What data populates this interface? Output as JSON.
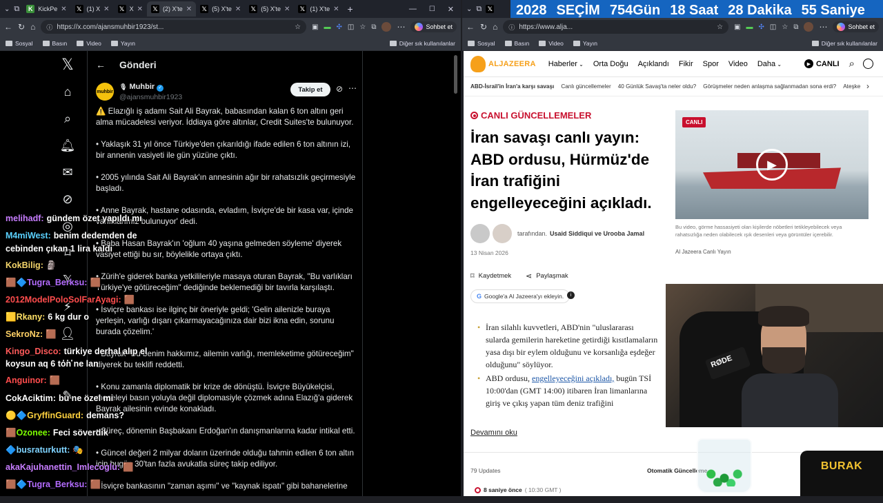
{
  "left_browser": {
    "tabs": [
      {
        "label": "KickPe",
        "active": false
      },
      {
        "label": "(1) X",
        "active": false
      },
      {
        "label": "X",
        "active": false
      },
      {
        "label": "(2) X'te",
        "active": true
      },
      {
        "label": "(5) X'te",
        "active": false
      },
      {
        "label": "(5) X'te",
        "active": false
      },
      {
        "label": "(1) X'te",
        "active": false
      }
    ],
    "url": "https://x.com/ajansmuhbir1923/st...",
    "copilot_label": "Sohbet et",
    "bookmarks": [
      "Sosyal",
      "Basın",
      "Video",
      "Yayın"
    ],
    "other_bookmarks": "Diğer sık kullanılanlar"
  },
  "x_post": {
    "header_title": "Gönderi",
    "author_name": "Muhbir",
    "author_handle": "@ajansmuhbir1923",
    "avatar_text": "muhbir",
    "follow_label": "Takip et",
    "paragraphs": [
      "⚠️ Elazığlı iş adamı Sait Ali Bayrak, babasından kalan 6 ton altını geri alma mücadelesi veriyor. İddiaya göre altınlar, Credit Suites'te bulunuyor.",
      "• Yaklaşık 31 yıl önce Türkiye'den çıkarıldığı ifade edilen 6 ton altının izi, bir annenin vasiyeti ile gün yüzüne çıktı.",
      "• 2005 yılında Sait Ali Bayrak'ın annesinin ağır bir rahatsızlık geçirmesiyle başladı.",
      "• Anne Bayrak, hastane odasında, evladım, İsviçre'de bir kasa var, içinde varlıklarımız bulunuyor' dedi.",
      "• Baba Hasan Bayrak'ın 'oğlum 40 yaşına gelmeden söyleme' diyerek vasiyet ettiği bu sır, böylelikle ortaya çıktı.",
      "• Zürih'e giderek banka yetkilileriyle masaya oturan Bayrak, \"Bu varlıkları Türkiye'ye götüreceğim\" dediğinde beklemediği bir tavırla karşılaştı.",
      "• İsviçre bankası ise ilginç bir öneriyle geldi; 'Gelin ailenizle buraya yerleşin, varlığı dışarı çıkarmayacağınıza dair bizi ikna edin, sorunu burada çözelim.'",
      "• Bayrak \"Bu benim hakkımız, ailemin varlığı, memleketime götüreceğim\" diyerek bu teklifi reddetti.",
      "• Konu zamanla diplomatik bir krize de dönüştü. İsviçre Büyükelçisi, meseleyi basın yoluyla değil diplomasiyle çözmek adına Elazığ'a giderek Bayrak ailesinin evinde konakladı.",
      "• Süreç, dönemin Başbakanı Erdoğan'ın danışmanlarına kadar intikal etti.",
      "• Güncel değeri 2 milyar doların üzerinde olduğu tahmin edilen 6 ton altın için bugün 30'tan fazla avukatla süreç takip ediliyor.",
      "• İsviçre bankasının \"zaman aşımı\" ve \"kaynak ispatı\" gibi bahanelerine"
    ]
  },
  "chat": [
    {
      "user": "melihadf:",
      "user_color": "#c77dff",
      "msg": "gündem özet yapıldı mı"
    },
    {
      "user": "M4miWest:",
      "user_color": "#5ad1ff",
      "msg": "benim dedemden de"
    },
    {
      "user": "",
      "user_color": "#fff",
      "msg": "cebinden çıkan 1 lira kaldı"
    },
    {
      "user": "KokBilig:",
      "user_color": "#f5d66b",
      "msg": "🗿"
    },
    {
      "user": "Tugra_Berksu:",
      "user_color": "#b46cff",
      "msg": "🟫"
    },
    {
      "user": "2012ModelPoloSolFarAyagi:",
      "user_color": "#ff4d4d",
      "msg": "🟫"
    },
    {
      "user": "Rkany:",
      "user_color": "#ffe066",
      "msg": "6 kg dur o"
    },
    {
      "user": "SekroNz:",
      "user_color": "#ffd166",
      "msg": "🟫"
    },
    {
      "user": "Kingo_Disco:",
      "user_color": "#ff5a5a",
      "msg": "türkiye derhal alıp el"
    },
    {
      "user": "",
      "user_color": "#fff",
      "msg": "koysun aq 6 ton ne lan"
    },
    {
      "user": "Anguinor:",
      "user_color": "#ff4d4d",
      "msg": "🟫"
    },
    {
      "user": "CokAciktim:",
      "user_color": "#ffffff",
      "msg": "bu ne özel mi"
    },
    {
      "user": "GryffinGuard:",
      "user_color": "#ffd23f",
      "msg": "demans?"
    },
    {
      "user": "Ozonee:",
      "user_color": "#7CFC00",
      "msg": "Feci söverdik"
    },
    {
      "user": "busraturkutt:",
      "user_color": "#7fd3ff",
      "msg": "🎭"
    },
    {
      "user": "akaKajuhanettin_Imlecoglu:",
      "user_color": "#c77dff",
      "msg": "🟫"
    },
    {
      "user": "Tugra_Berksu:",
      "user_color": "#b46cff",
      "msg": "🟫"
    }
  ],
  "countdown": {
    "year": "2028",
    "word": "SEÇİM",
    "days": "754",
    "days_label": "Gün",
    "hours": "18",
    "hours_label": "Saat",
    "minutes": "28",
    "minutes_label": "Dakika",
    "seconds": "55",
    "seconds_label": "Saniye"
  },
  "right_browser": {
    "url": "https://www.alja...",
    "copilot_label": "Sohbet et",
    "bookmarks": [
      "Sosyal",
      "Basın",
      "Video",
      "Yayın"
    ],
    "other_bookmarks": "Diğer sık kullanılanlar"
  },
  "aljazeera": {
    "logo": "ALJAZEERA",
    "nav": [
      "Haberler",
      "Orta Doğu",
      "Açıklandı",
      "Fikir",
      "Spor",
      "Video",
      "Daha"
    ],
    "live_btn": "CANLI",
    "subnav": [
      "ABD-İsrail'in İran'a karşı savaşı",
      "Canlı güncellemeler",
      "40 Günlük Savaş'ta neler oldu?",
      "Görüşmeler neden anlaşma sağlanmadan sona erdi?",
      "Ateşke"
    ],
    "kicker": "CANLI GÜNCELLEMELER",
    "headline": "İran savaşı canlı yayın: ABD ordusu, Hürmüz'de İran trafiğini engelleyeceğini açıkladı.",
    "byline_prefix": "tarafından.",
    "byline_authors": "Usaid Siddiqui ve Urooba Jamal",
    "date": "13 Nisan 2026",
    "save_label": "Kaydetmek",
    "share_label": "Paylaşmak",
    "google_label": "Google'a Al Jazeera'yı ekleyin.",
    "video_badge": "CANLI",
    "video_caption": "Bu video, görme hassasiyeti olan kişilerde nöbetleri tetikleyebilecek veya rahatsızlığa neden olabilecek ışık desenleri veya görüntüler içerebilir.",
    "video_source": "Al Jazeera Canlı Yayın",
    "bullet1": "İran silahlı kuvvetleri, ABD'nin \"uluslararası sularda gemilerin hareketine getirdiği kısıtlamaların yasa dışı bir eylem olduğunu ve korsanlığa eşdeğer olduğunu\" söylüyor.",
    "bullet2_pre": "ABD ordusu,",
    "bullet2_link": "engelleyeceğini açıkladı,",
    "bullet2_post": "bugün TSİ 10:00'dan (GMT 14:00) itibaren İran limanlarına giriş ve çıkış yapan tüm deniz trafiğini",
    "read_more": "Devamını oku",
    "updates_count": "79 Updates",
    "auto_label": "Otomatik Güncelleme",
    "update_time": "8 saniye önce",
    "update_clock": "( 10:30 GMT )"
  },
  "overlay": {
    "mic_brand": "RØDE",
    "streamer_badge": "BURAK"
  }
}
